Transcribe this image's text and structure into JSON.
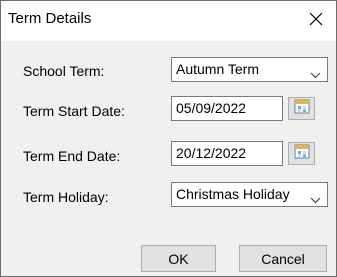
{
  "dialog": {
    "title": "Term Details",
    "close_icon": "close-icon"
  },
  "form": {
    "school_term": {
      "label": "School Term:",
      "value": "Autumn Term"
    },
    "term_start_date": {
      "label": "Term Start Date:",
      "value": "05/09/2022",
      "icon": "calendar-icon"
    },
    "term_end_date": {
      "label": "Term End Date:",
      "value": "20/12/2022",
      "icon": "calendar-icon"
    },
    "term_holiday": {
      "label": "Term Holiday:",
      "value": "Christmas Holiday"
    }
  },
  "buttons": {
    "ok": "OK",
    "cancel": "Cancel"
  }
}
